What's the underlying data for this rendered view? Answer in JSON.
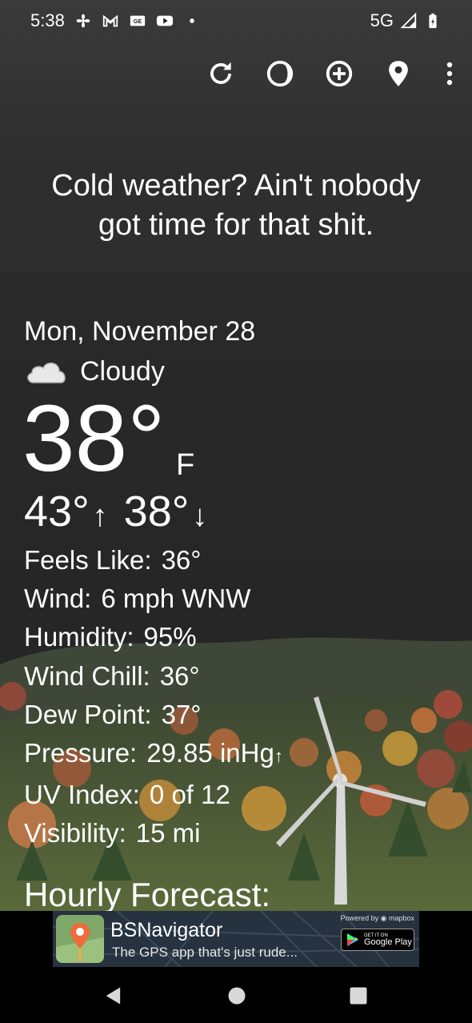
{
  "status_bar": {
    "time": "5:38",
    "network": "5G",
    "left_icons": [
      "fan-icon",
      "gmail-icon",
      "news-icon",
      "youtube-icon",
      "dot-icon"
    ],
    "right_icons": [
      "signal-icon",
      "battery-icon"
    ]
  },
  "toolbar": {
    "icons": [
      "refresh-icon",
      "moon-phase-icon",
      "add-location-icon",
      "location-pin-icon",
      "more-vert-icon"
    ]
  },
  "tagline": {
    "line1": "Cold weather? Ain't nobody",
    "line2": "got time for that shit."
  },
  "current": {
    "date": "Mon, November 28",
    "condition": "Cloudy",
    "condition_icon": "cloud-icon",
    "temperature": "38°",
    "unit": "F",
    "high": "43°",
    "high_arrow": "↑",
    "low": "38°",
    "low_arrow": "↓"
  },
  "details": [
    {
      "label": "Feels Like:",
      "value": "36°"
    },
    {
      "label": "Wind:",
      "value": "6 mph WNW"
    },
    {
      "label": "Humidity:",
      "value": "95%"
    },
    {
      "label": "Wind Chill:",
      "value": "36°"
    },
    {
      "label": "Dew Point:",
      "value": "37°"
    },
    {
      "label": "Pressure:",
      "value": "29.85 inHg",
      "trend": "↑"
    },
    {
      "label": "UV Index:",
      "value": "0 of 12"
    },
    {
      "label": "Visibility:",
      "value": "15 mi"
    }
  ],
  "hourly": {
    "title": "Hourly Forecast:"
  },
  "ad": {
    "title": "BSNavigator",
    "subtitle": "The GPS app that's just rude...",
    "powered_by": "Powered by",
    "brand": "mapbox",
    "play_small": "GET IT ON",
    "play_big": "Google Play"
  },
  "nav": {
    "icons": [
      "back-icon",
      "home-icon",
      "recents-icon"
    ]
  },
  "colors": {
    "sky": "#262626",
    "hills": "#4a5a3a",
    "text": "#ffffff"
  }
}
